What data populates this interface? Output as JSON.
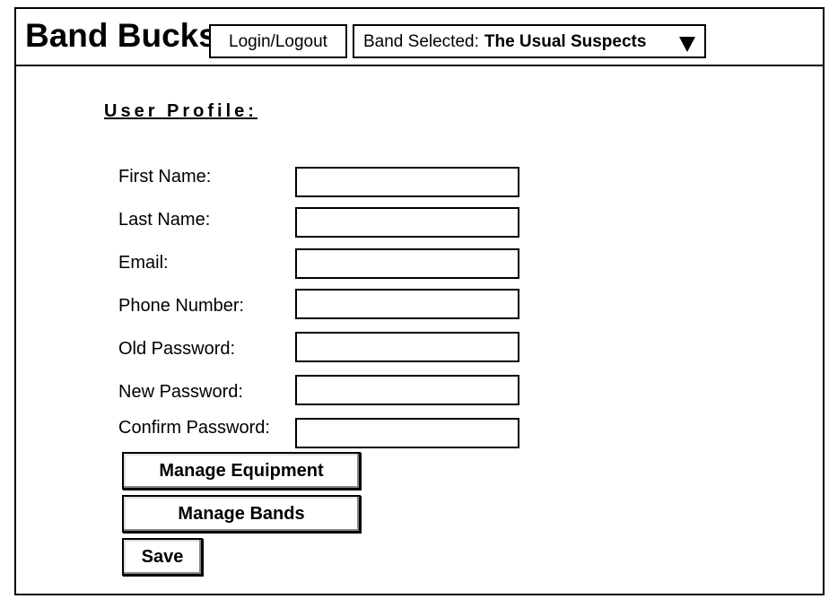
{
  "header": {
    "app_title": "Band Bucks",
    "login_label": "Login/Logout",
    "band_selected_label": "Band Selected:",
    "band_selected_value": "The Usual Suspects"
  },
  "profile": {
    "section_title": "User Profile:",
    "fields": [
      {
        "label": "First Name:",
        "value": ""
      },
      {
        "label": "Last Name:",
        "value": ""
      },
      {
        "label": "Email:",
        "value": ""
      },
      {
        "label": "Phone Number:",
        "value": ""
      },
      {
        "label": "Old Password:",
        "value": ""
      },
      {
        "label": "New Password:",
        "value": ""
      },
      {
        "label": "Confirm Password:",
        "value": ""
      }
    ]
  },
  "buttons": {
    "manage_equipment": "Manage Equipment",
    "manage_bands": "Manage Bands",
    "save": "Save"
  }
}
